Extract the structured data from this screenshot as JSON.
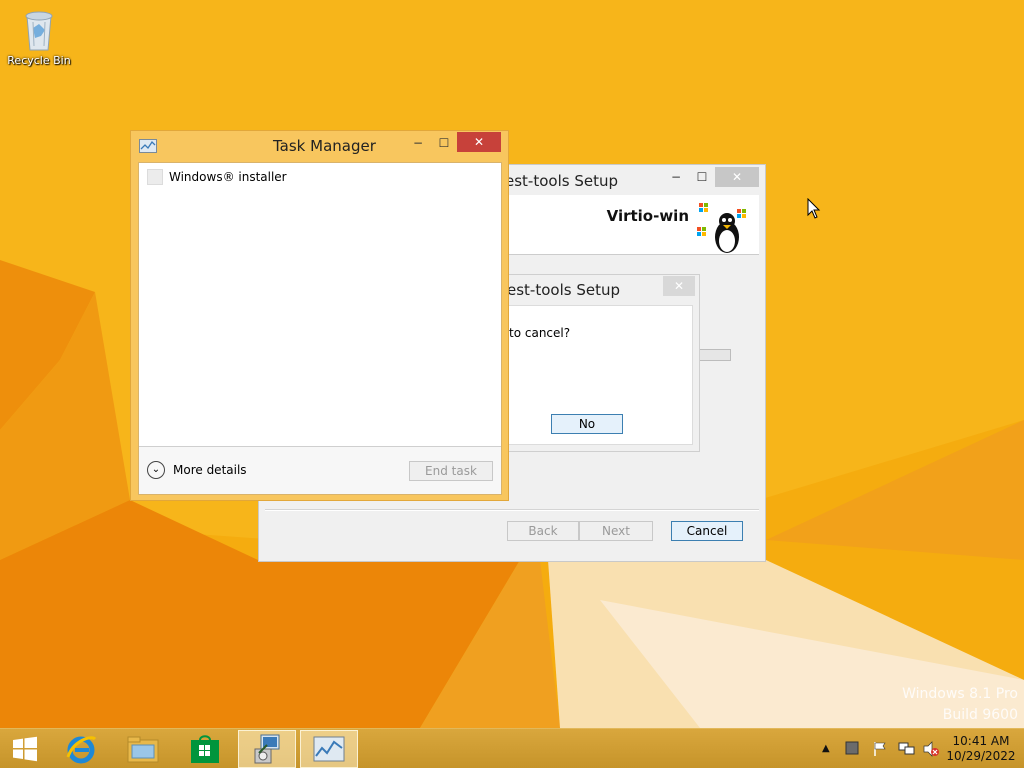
{
  "desktop": {
    "recycle_bin_label": "Recycle Bin",
    "watermark_line1": "Windows 8.1 Pro",
    "watermark_line2": "Build 9600"
  },
  "setup_window": {
    "title": "est-tools Setup",
    "brand": "Virtio-win",
    "buttons": {
      "back": "Back",
      "next": "Next",
      "cancel": "Cancel"
    },
    "caption": {
      "minimize": "−",
      "maximize": "☐",
      "close": "✕"
    }
  },
  "confirm_dialog": {
    "title": "est-tools Setup",
    "message": "to cancel?",
    "no_button": "No",
    "close": "✕"
  },
  "task_manager": {
    "title": "Task Manager",
    "apps": [
      {
        "name": "Windows® installer"
      }
    ],
    "more_details": "More details",
    "end_task": "End task",
    "caption": {
      "minimize": "−",
      "maximize": "☐",
      "close": "✕"
    }
  },
  "taskbar": {
    "items": [
      "start",
      "internet-explorer",
      "file-explorer",
      "store",
      "setup-installer",
      "task-manager"
    ],
    "clock_time": "10:41 AM",
    "clock_date": "10/29/2022",
    "tray_chevron": "▲"
  },
  "colors": {
    "desktop_orange": "#f4a80c",
    "task_manager_frame": "#f8c65e",
    "close_red": "#c7413a",
    "taskbar": "#c99a2e"
  }
}
